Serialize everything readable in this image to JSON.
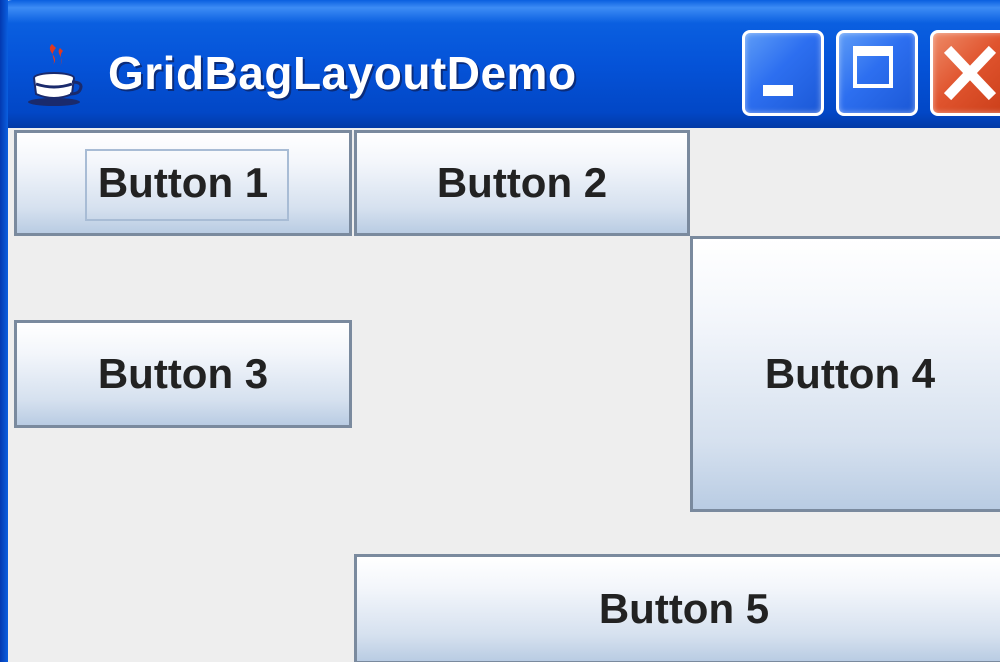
{
  "window": {
    "title": "GridBagLayoutDemo",
    "icon": "java-coffee-cup-icon",
    "controls": [
      "minimize-icon",
      "maximize-icon",
      "close-icon"
    ]
  },
  "buttons": [
    {
      "label": "Button 1",
      "focused": true
    },
    {
      "label": "Button 2"
    },
    {
      "label": "Button 3"
    },
    {
      "label": "Button 4"
    },
    {
      "label": "Button 5"
    }
  ],
  "colors": {
    "titlebar": "#0553d8",
    "close_button": "#e0542e",
    "content_background": "#eeeeee",
    "button_border": "#7a8a9e"
  }
}
